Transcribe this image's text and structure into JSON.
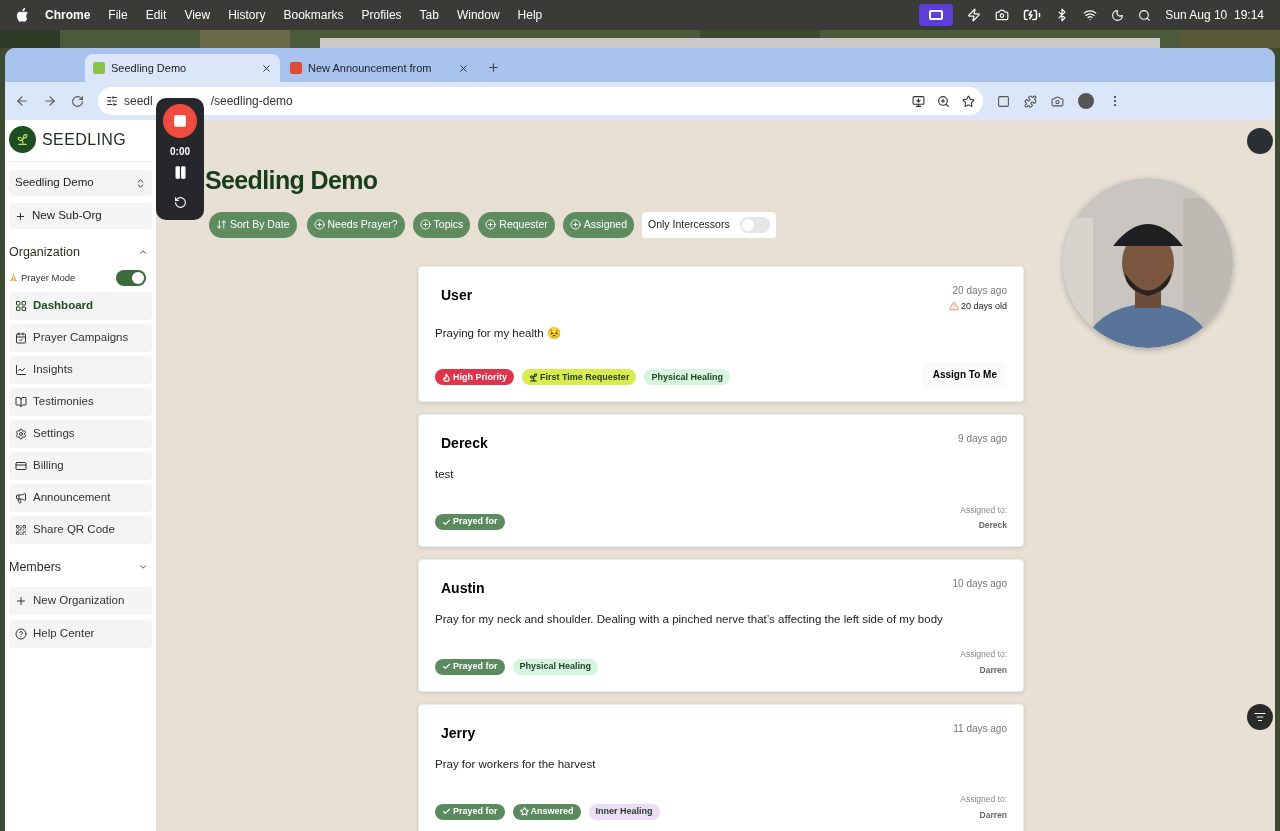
{
  "menu_bar": {
    "app": "Chrome",
    "menus": [
      "File",
      "Edit",
      "View",
      "History",
      "Bookmarks",
      "Profiles",
      "Tab",
      "Window",
      "Help"
    ],
    "clock": "Sun Aug 10  19:14"
  },
  "browser": {
    "tabs": [
      {
        "title": "Seedling Demo",
        "selected": true
      },
      {
        "title": "New Announcement from",
        "selected": false
      }
    ],
    "url_visible": [
      "seedl",
      "/seedling-demo"
    ]
  },
  "recorder": {
    "time": "0:00"
  },
  "sidebar": {
    "brand": "SEEDLING",
    "org_select": "Seedling Demo",
    "new_sub_org": "New Sub-Org",
    "organization": {
      "title": "Organization",
      "expanded": true
    },
    "prayer_mode": {
      "label": "Prayer Mode",
      "on": true
    },
    "nav": [
      {
        "label": "Dashboard",
        "selected": true
      },
      {
        "label": "Prayer Campaigns",
        "selected": false
      },
      {
        "label": "Insights",
        "selected": false
      },
      {
        "label": "Testimonies",
        "selected": false
      },
      {
        "label": "Settings",
        "selected": false
      },
      {
        "label": "Billing",
        "selected": false
      },
      {
        "label": "Announcement",
        "selected": false
      },
      {
        "label": "Share QR Code",
        "selected": false
      }
    ],
    "members": {
      "title": "Members",
      "expanded": false
    },
    "footer": [
      "New Organization",
      "Help Center"
    ]
  },
  "main": {
    "title": "Seedling Demo",
    "filters": [
      {
        "label": "Sort By Date",
        "kind": "sort"
      },
      {
        "label": "Needs Prayer?",
        "kind": "add"
      },
      {
        "label": "Topics",
        "kind": "add"
      },
      {
        "label": "Requester",
        "kind": "add"
      },
      {
        "label": "Assigned",
        "kind": "add"
      }
    ],
    "intercessors": {
      "label": "Only Intercessors",
      "on": false
    },
    "cards": [
      {
        "name": "User",
        "time": "20 days ago",
        "age_warning": "20 days old",
        "message": "Praying for my health 😣",
        "tags": [
          {
            "label": "High Priority",
            "kind": "priority",
            "color": "#e0334c"
          },
          {
            "label": "First Time Requester",
            "kind": "newcomer",
            "color": "#d9eb4f"
          },
          {
            "label": "Physical Healing",
            "kind": "topic",
            "color": "#d5f5df"
          }
        ],
        "action": "Assign To Me"
      },
      {
        "name": "Dereck",
        "time": "9 days ago",
        "message": "test",
        "tags": [
          {
            "label": "Prayed for",
            "kind": "prayed",
            "color": "#5b8a5e"
          }
        ],
        "assigned_label": "Assigned to:",
        "assigned": "Dereck"
      },
      {
        "name": "Austin",
        "time": "10 days ago",
        "message": "Pray for my neck and shoulder. Dealing with a pinched nerve that’s affecting the left side of my body",
        "tags": [
          {
            "label": "Prayed for",
            "kind": "prayed",
            "color": "#5b8a5e"
          },
          {
            "label": "Physical Healing",
            "kind": "topic",
            "color": "#d5f5df"
          }
        ],
        "assigned_label": "Assigned to:",
        "assigned": "Darren"
      },
      {
        "name": "Jerry",
        "time": "11 days ago",
        "message": "Pray for workers for the harvest",
        "tags": [
          {
            "label": "Prayed for",
            "kind": "prayed",
            "color": "#5b8a5e"
          },
          {
            "label": "Answered",
            "kind": "answered",
            "color": "#5b8a5e"
          },
          {
            "label": "Inner Healing",
            "kind": "topic",
            "color": "#ecdcf7"
          }
        ],
        "assigned_label": "Assigned to:",
        "assigned": "Darren"
      }
    ]
  }
}
